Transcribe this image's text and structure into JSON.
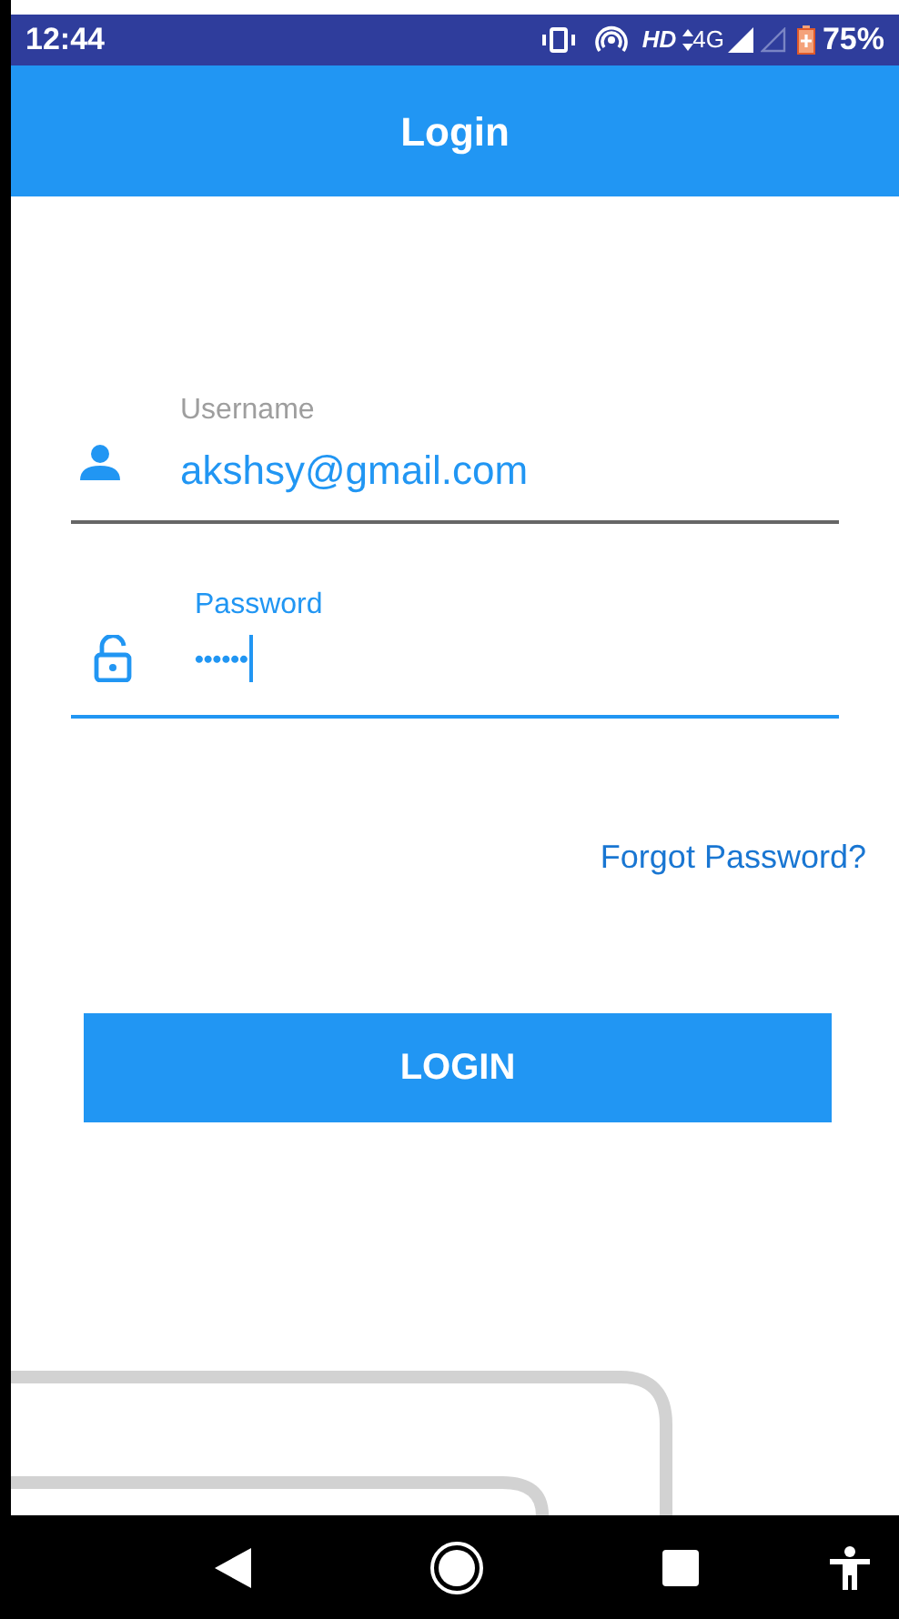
{
  "status_bar": {
    "time": "12:44",
    "hd": "HD",
    "network": "4G",
    "battery": "75%"
  },
  "app_bar": {
    "title": "Login"
  },
  "fields": [
    {
      "kind": "user",
      "label": "Username",
      "value": "akshsy@gmail.com",
      "focused": false
    },
    {
      "kind": "lock",
      "label": "Password",
      "value": "••••••",
      "focused": true
    }
  ],
  "forgot_link": "Forgot Password?",
  "login_button": "LOGIN"
}
